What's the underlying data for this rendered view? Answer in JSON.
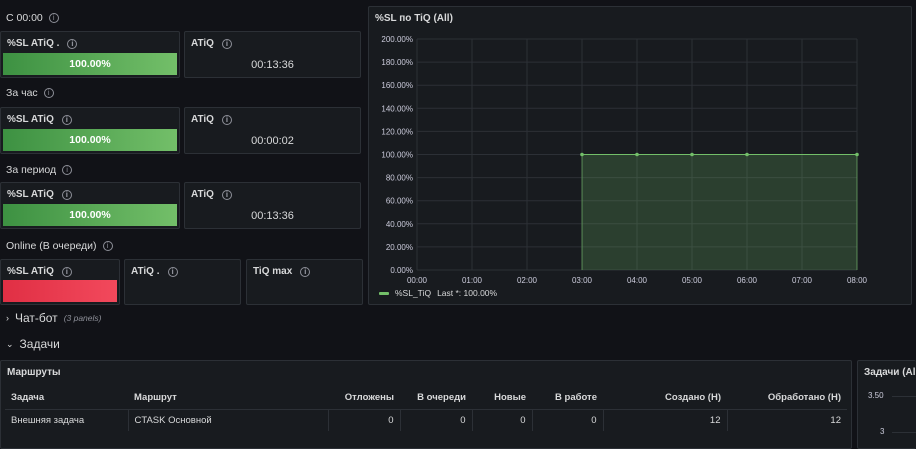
{
  "sections": {
    "since_midnight": "С 00:00",
    "per_hour": "За час",
    "per_period": "За период",
    "online": "Online (В очереди)"
  },
  "stats": {
    "sl_label": "%SL ATiQ .",
    "sl_label_plain": "%SL ATiQ",
    "atiq_label": "ATiQ",
    "atiq_dot_label": "ATiQ .",
    "tiqmax_label": "TiQ max",
    "row1_sl": "100.00%",
    "row1_atiq": "00:13:36",
    "row2_sl": "100.00%",
    "row2_atiq": "00:00:02",
    "row3_sl": "100.00%",
    "row3_atiq": "00:13:36",
    "colors": {
      "green": "#73bf69",
      "red": "#f2495c"
    }
  },
  "chart_panel": {
    "title": "%SL по TiQ (All)",
    "legend": "%SL_TiQ",
    "legend_last": "Last *: 100.00%"
  },
  "chart_data": {
    "type": "area",
    "x": [
      "03:00",
      "04:00",
      "05:00",
      "06:00",
      "08:00"
    ],
    "x_ticks": [
      "00:00",
      "01:00",
      "02:00",
      "03:00",
      "04:00",
      "05:00",
      "06:00",
      "07:00",
      "08:00"
    ],
    "y_ticks": [
      "0.00%",
      "20.00%",
      "40.00%",
      "60.00%",
      "80.00%",
      "100.00%",
      "120.00%",
      "140.00%",
      "160.00%",
      "180.00%",
      "200.00%"
    ],
    "series": [
      {
        "name": "%SL_TiQ",
        "values": [
          100,
          100,
          100,
          100,
          100
        ]
      }
    ],
    "ylim": [
      0,
      200
    ],
    "xlim_hours": [
      0,
      8
    ],
    "color": "#73bf69"
  },
  "rows": {
    "chatbot": "Чат-бот",
    "chatbot_count": "(3 panels)",
    "tasks": "Задачи"
  },
  "routes_panel": {
    "title": "Маршруты",
    "columns": [
      "Задача",
      "Маршрут",
      "Отложены",
      "В очереди",
      "Новые",
      "В работе",
      "Создано (Н)",
      "Обработано (Н)"
    ],
    "rows": [
      [
        "Внешняя задача",
        "CTASK Основной",
        "0",
        "0",
        "0",
        "0",
        "12",
        "12"
      ]
    ]
  },
  "tasks_panel": {
    "title": "Задачи (All",
    "y_ticks": [
      "3.50",
      "3"
    ]
  }
}
